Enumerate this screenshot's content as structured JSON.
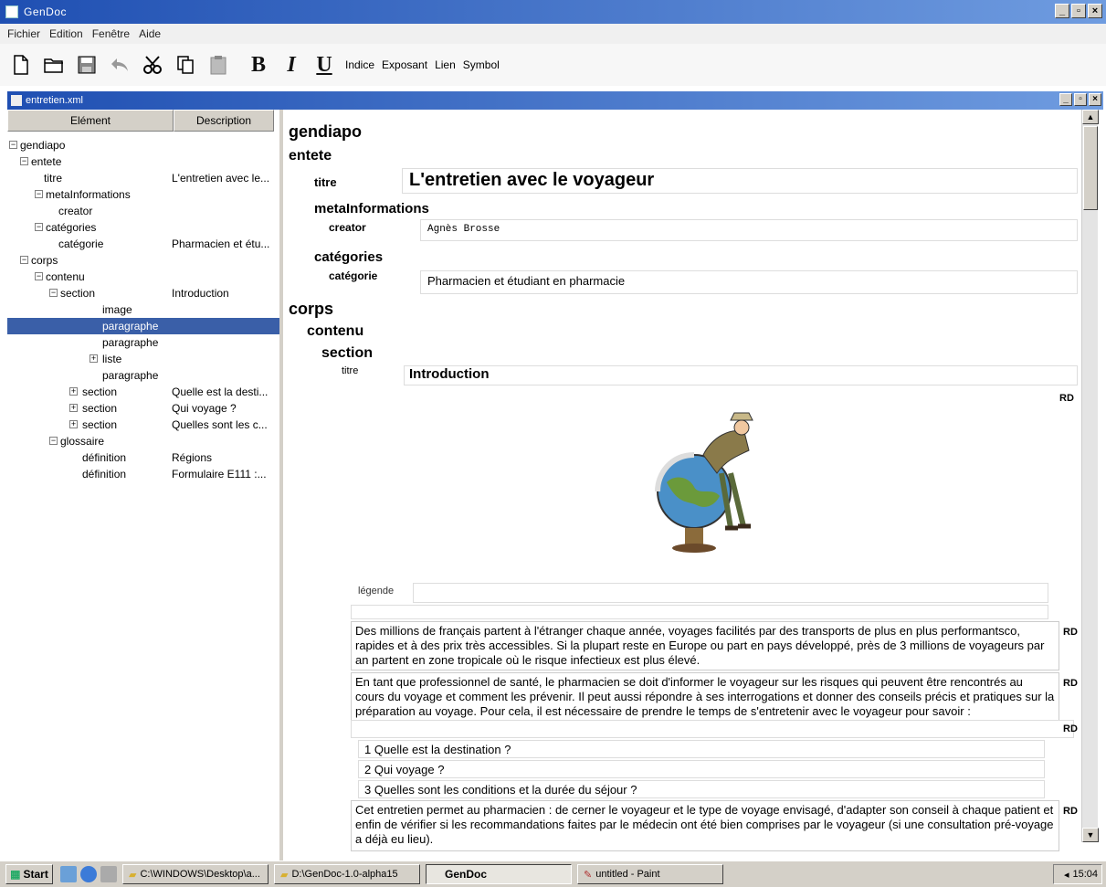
{
  "app": {
    "title": "GenDoc"
  },
  "menu": [
    "Fichier",
    "Edition",
    "Fenêtre",
    "Aide"
  ],
  "toolbar": {
    "bold": "B",
    "italic": "I",
    "underline": "U",
    "text_buttons": [
      "Indice",
      "Exposant",
      "Lien",
      "Symbol"
    ]
  },
  "document": {
    "title": "entretien.xml"
  },
  "tree": {
    "headers": {
      "element": "Elément",
      "description": "Description"
    },
    "rows": [
      {
        "label": "gendiapo",
        "desc": ""
      },
      {
        "label": "entete",
        "desc": ""
      },
      {
        "label": "titre",
        "desc": "L'entretien avec le..."
      },
      {
        "label": "metaInformations",
        "desc": ""
      },
      {
        "label": "creator",
        "desc": ""
      },
      {
        "label": "catégories",
        "desc": ""
      },
      {
        "label": "catégorie",
        "desc": "Pharmacien et étu..."
      },
      {
        "label": "corps",
        "desc": ""
      },
      {
        "label": "contenu",
        "desc": ""
      },
      {
        "label": "section",
        "desc": "Introduction"
      },
      {
        "label": "image",
        "desc": ""
      },
      {
        "label": "paragraphe",
        "desc": ""
      },
      {
        "label": "paragraphe",
        "desc": ""
      },
      {
        "label": "liste",
        "desc": ""
      },
      {
        "label": "paragraphe",
        "desc": ""
      },
      {
        "label": "section",
        "desc": "Quelle est la desti..."
      },
      {
        "label": "section",
        "desc": "Qui voyage ?"
      },
      {
        "label": "section",
        "desc": "Quelles sont les c..."
      },
      {
        "label": "glossaire",
        "desc": ""
      },
      {
        "label": "définition",
        "desc": "Régions"
      },
      {
        "label": "définition",
        "desc": "Formulaire E111 :..."
      }
    ]
  },
  "content": {
    "root": "gendiapo",
    "entete": "entete",
    "titre_tag": "titre",
    "titre_value": "L'entretien avec le voyageur",
    "meta_tag": "metaInformations",
    "creator_tag": "creator",
    "creator_value": "Agnès Brosse",
    "categories_tag": "catégories",
    "categorie_tag": "catégorie",
    "categorie_value": "Pharmacien et étudiant en pharmacie",
    "corps": "corps",
    "contenu": "contenu",
    "section": "section",
    "section_titre_tag": "titre",
    "section_titre_value": "Introduction",
    "rd": "RD",
    "legende_tag": "légende",
    "para1": "Des millions de français partent à l'étranger chaque année, voyages facilités par des transports de plus en plus performantsco, rapides et à des prix très accessibles. Si la plupart reste en Europe ou part en pays développé, près de 3 millions de voyageurs par an partent en zone tropicale où le risque infectieux est plus élevé.",
    "para2": "En tant que professionnel de santé, le pharmacien se doit d'informer le voyageur sur les risques qui peuvent être rencontrés au cours du voyage et comment les prévenir. Il peut aussi répondre à ses interrogations et donner des conseils précis et pratiques sur la préparation au voyage. Pour cela, il est nécessaire de prendre le temps de s'entretenir avec le voyageur pour savoir :",
    "list": [
      "1 Quelle est la destination ?",
      "2 Qui voyage ?",
      "3 Quelles sont les conditions et la durée du séjour ?"
    ],
    "para3": "Cet entretien permet au pharmacien : de cerner le voyageur et le type de voyage envisagé, d'adapter son conseil à chaque patient et enfin de vérifier si les recommandations faites par le médecin ont été bien comprises par le voyageur (si une consultation pré-voyage a déjà eu lieu)."
  },
  "taskbar": {
    "start": "Start",
    "tasks": [
      "C:\\WINDOWS\\Desktop\\a...",
      "D:\\GenDoc-1.0-alpha15",
      "GenDoc",
      "untitled - Paint"
    ],
    "clock": "15:04"
  }
}
